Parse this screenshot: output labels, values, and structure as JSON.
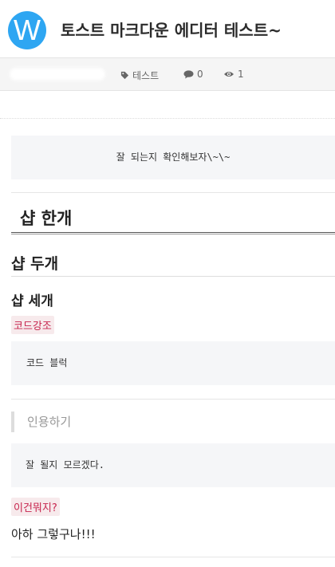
{
  "header": {
    "logo_letter": "W",
    "title": "토스트 마크다운 에디터 테스트~"
  },
  "meta": {
    "tag_label": "테스트",
    "comment_count": "0",
    "view_count": "1"
  },
  "content": {
    "centered_text": "잘 되는지 확인해보자\\~\\~",
    "heading1": "샵 한개",
    "heading2": "샵 두개",
    "heading3": "샵 세개",
    "inline_code_1": "코드강조",
    "code_block": "코드 블럭",
    "blockquote": "인용하기",
    "pre_block": "잘 될지 모르겠다.",
    "inline_code_2": "이건뭐지?",
    "paragraph": "아하 그렇구나!!!"
  },
  "colors": {
    "logo_bg": "#2ea6f2",
    "code_text": "#c7254e",
    "code_bg": "#f7eaec",
    "block_bg": "#f5f6f8"
  }
}
